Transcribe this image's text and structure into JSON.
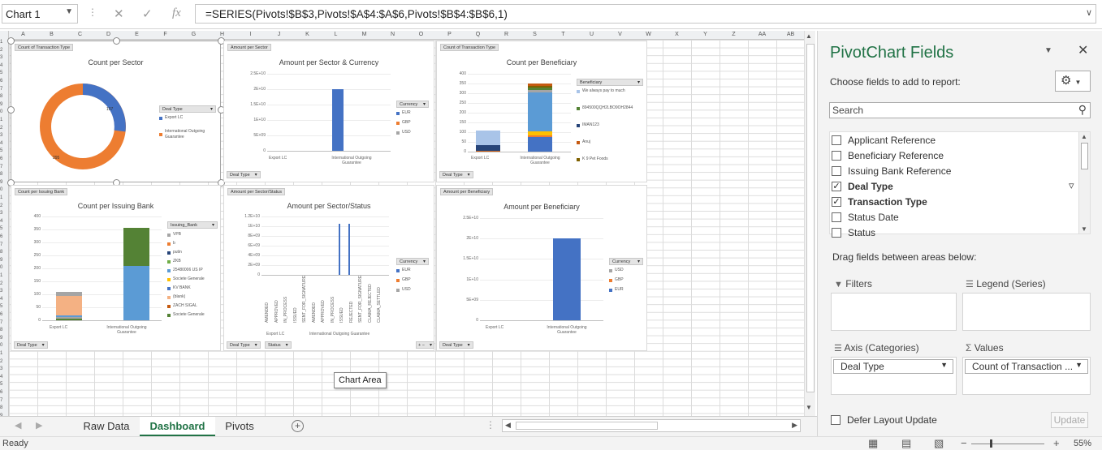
{
  "formula_bar": {
    "name_box": "Chart 1",
    "formula": "=SERIES(Pivots!$B$3,Pivots!$A$4:$A$6,Pivots!$B$4:$B$6,1)"
  },
  "columns": [
    "A",
    "B",
    "C",
    "D",
    "E",
    "F",
    "G",
    "H",
    "I",
    "J",
    "K",
    "L",
    "M",
    "N",
    "O",
    "P",
    "Q",
    "R",
    "S",
    "T",
    "U",
    "V",
    "W",
    "X",
    "Y",
    "Z",
    "AA",
    "AB"
  ],
  "charts": {
    "c1": {
      "tag": "Count of Transaction Type",
      "title": "Count per Sector",
      "filter": "Deal Type",
      "legend_header": "Deal Type",
      "legend": [
        "Export LC",
        "International Outgoing Guarantee"
      ],
      "label_a": "107",
      "label_b": "295"
    },
    "c2": {
      "tag": "Amount per Sector",
      "title": "Amount per Sector & Currency",
      "filter": "Deal Type",
      "legend_header": "Currency",
      "legend": [
        "EUR",
        "GBP",
        "USD"
      ],
      "yticks": [
        "2.5E+10",
        "2E+10",
        "1.5E+10",
        "1E+10",
        "5E+09",
        "0"
      ],
      "cats": [
        "Export LC",
        "International Outgoing Guarantee"
      ]
    },
    "c3": {
      "tag": "Count of Transaction Type",
      "title": "Count per Beneficiary",
      "filter": "Deal Type",
      "legend_header": "Beneficiary",
      "legend": [
        "We always pay to much",
        "894500QQH2LBO9OH2844",
        "IMAN123",
        "Anuj",
        "K 9 Pet Foods"
      ],
      "yticks": [
        "400",
        "350",
        "300",
        "250",
        "200",
        "150",
        "100",
        "50",
        "0"
      ],
      "cats": [
        "Export LC",
        "International Outgoing Guarantee"
      ]
    },
    "c4": {
      "tag": "Count per Issuing Bank",
      "title": "Count per Issuing Bank",
      "filter": "Deal Type",
      "legend_header": "Issuing_Bank",
      "legend": [
        "VPB",
        "b",
        "putin",
        "ZKB",
        "25480006 US IP",
        "Societe Generale",
        "KV BANK",
        "(blank)",
        "ZACH SIGAL",
        "Societe Generale"
      ],
      "yticks": [
        "400",
        "350",
        "300",
        "250",
        "200",
        "150",
        "100",
        "50",
        "0"
      ],
      "cats": [
        "Export LC",
        "International Outgoing Guarantee"
      ]
    },
    "c5": {
      "tag": "Amount per Sector/Status",
      "title": "Amount per Sector/Status",
      "filter": "Deal Type",
      "filter2": "Status",
      "legend_header": "Currency",
      "legend": [
        "EUR",
        "GBP",
        "USD"
      ],
      "yticks": [
        "1.2E+10",
        "1E+10",
        "8E+09",
        "6E+09",
        "4E+09",
        "2E+09",
        "0"
      ],
      "statuses": [
        "AMENDED",
        "APPROVED",
        "IN_PROCESS",
        "ISSUED",
        "SENT_FOR_SIGNATURE",
        "AMENDED",
        "APPROVED",
        "IN_PROCESS",
        "ISSUED",
        "REJECTED",
        "SENT_FOR_SIGNATURE",
        "CLAIMA_REJECTED",
        "CLAIMA_SETTLED"
      ],
      "cats": [
        "Export LC",
        "International Outgoing Guarantee"
      ]
    },
    "c6": {
      "tag": "Amount per Beneficiary",
      "title": "Amount per Beneficiary",
      "filter": "Deal Type",
      "legend_header": "Currency",
      "legend": [
        "USD",
        "GBP",
        "EUR"
      ],
      "yticks": [
        "2.5E+10",
        "2E+10",
        "1.5E+10",
        "1E+10",
        "5E+09",
        "0"
      ],
      "cats": [
        "Export LC",
        "International Outgoing Guarantee"
      ]
    }
  },
  "chart_data": [
    {
      "type": "pie",
      "title": "Count per Sector",
      "categories": [
        "Export LC",
        "International Outgoing Guarantee"
      ],
      "values": [
        107,
        295
      ]
    },
    {
      "type": "bar",
      "title": "Amount per Sector & Currency",
      "categories": [
        "Export LC",
        "International Outgoing Guarantee"
      ],
      "series": [
        {
          "name": "EUR",
          "values": [
            0,
            20000000000
          ]
        }
      ],
      "ylim": [
        0,
        25000000000
      ]
    },
    {
      "type": "bar",
      "title": "Count per Beneficiary",
      "categories": [
        "Export LC",
        "International Outgoing Guarantee"
      ],
      "stacked": true,
      "totals": [
        108,
        350
      ],
      "ylim": [
        0,
        400
      ]
    },
    {
      "type": "bar",
      "title": "Count per Issuing Bank",
      "categories": [
        "Export LC",
        "International Outgoing Guarantee"
      ],
      "stacked": true,
      "totals": [
        108,
        355
      ],
      "ylim": [
        0,
        400
      ]
    },
    {
      "type": "bar",
      "title": "Amount per Sector/Status",
      "series": [
        {
          "name": "EUR",
          "values": [
            0,
            0,
            0,
            0,
            0,
            0,
            0,
            0,
            10500000000,
            10500000000,
            0,
            0,
            0
          ]
        }
      ],
      "ylim": [
        0,
        12000000000
      ]
    },
    {
      "type": "bar",
      "title": "Amount per Beneficiary",
      "categories": [
        "Export LC",
        "International Outgoing Guarantee"
      ],
      "series": [
        {
          "name": "EUR",
          "values": [
            0,
            20000000000
          ]
        }
      ],
      "ylim": [
        0,
        25000000000
      ]
    }
  ],
  "tooltip": "Chart Area",
  "sheet_tabs": [
    "Raw Data",
    "Dashboard",
    "Pivots"
  ],
  "status": "Ready",
  "zoom": "55%",
  "pane": {
    "title": "PivotChart Fields",
    "choose": "Choose fields to add to report:",
    "search_placeholder": "Search",
    "fields": [
      {
        "label": "Applicant Reference",
        "checked": false
      },
      {
        "label": "Beneficiary Reference",
        "checked": false
      },
      {
        "label": "Issuing Bank Reference",
        "checked": false
      },
      {
        "label": "Deal Type",
        "checked": true
      },
      {
        "label": "Transaction Type",
        "checked": true
      },
      {
        "label": "Status Date",
        "checked": false
      },
      {
        "label": "Status",
        "checked": false
      }
    ],
    "drag_label": "Drag fields between areas below:",
    "filters": "Filters",
    "legend": "Legend (Series)",
    "axis": "Axis (Categories)",
    "values": "Values",
    "axis_item": "Deal Type",
    "values_item": "Count of Transaction ...",
    "defer": "Defer Layout Update",
    "update": "Update"
  },
  "colors": {
    "blue": "#4472c4",
    "orange": "#ed7d31",
    "gray": "#a5a5a5",
    "green": "#548235",
    "lightblue": "#5b9bd5",
    "yellow": "#ffc000",
    "accent": "#217346"
  }
}
